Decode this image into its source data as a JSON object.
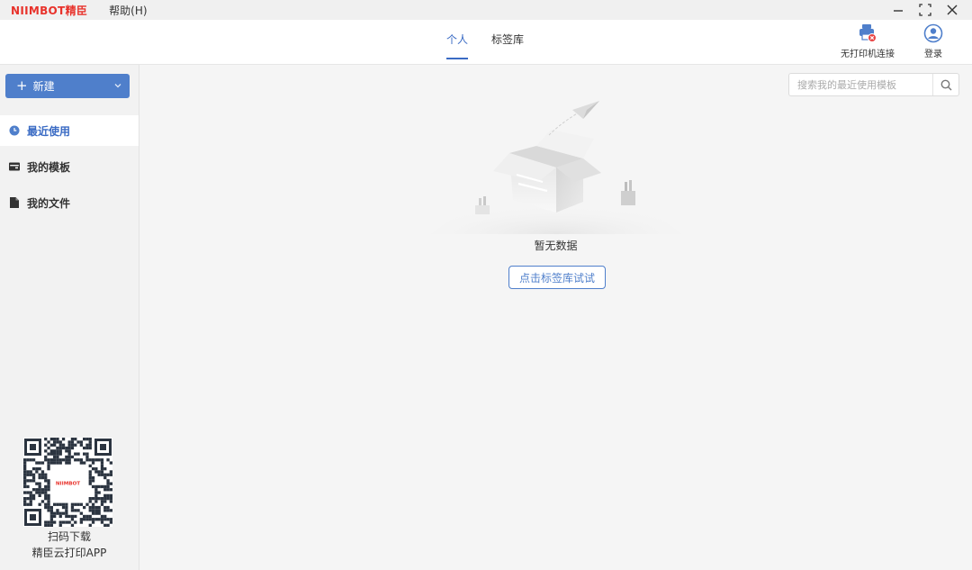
{
  "titlebar": {
    "logo_latin": "NIIMBOT",
    "logo_cjk": "精臣",
    "menu_help": "帮助(H)"
  },
  "header": {
    "tabs": [
      {
        "label": "个人",
        "active": true
      },
      {
        "label": "标签库",
        "active": false
      }
    ],
    "printer_status": "无打印机连接",
    "login": "登录"
  },
  "sidebar": {
    "new_button": "新建",
    "nav": [
      {
        "label": "最近使用",
        "icon": "clock-icon",
        "active": true
      },
      {
        "label": "我的模板",
        "icon": "template-icon",
        "active": false
      },
      {
        "label": "我的文件",
        "icon": "file-icon",
        "active": false
      }
    ],
    "qr_logo_text": "NIIMBOT",
    "qr_caption_1": "扫码下载",
    "qr_caption_2": "精臣云打印APP"
  },
  "main": {
    "search_placeholder": "搜索我的最近使用模板",
    "empty_text": "暂无数据",
    "try_button": "点击标签库试试"
  },
  "colors": {
    "accent": "#3a6bc4",
    "button_blue": "#4f7fcb",
    "brand_red": "#e8322b",
    "printer_error": "#e84545"
  }
}
